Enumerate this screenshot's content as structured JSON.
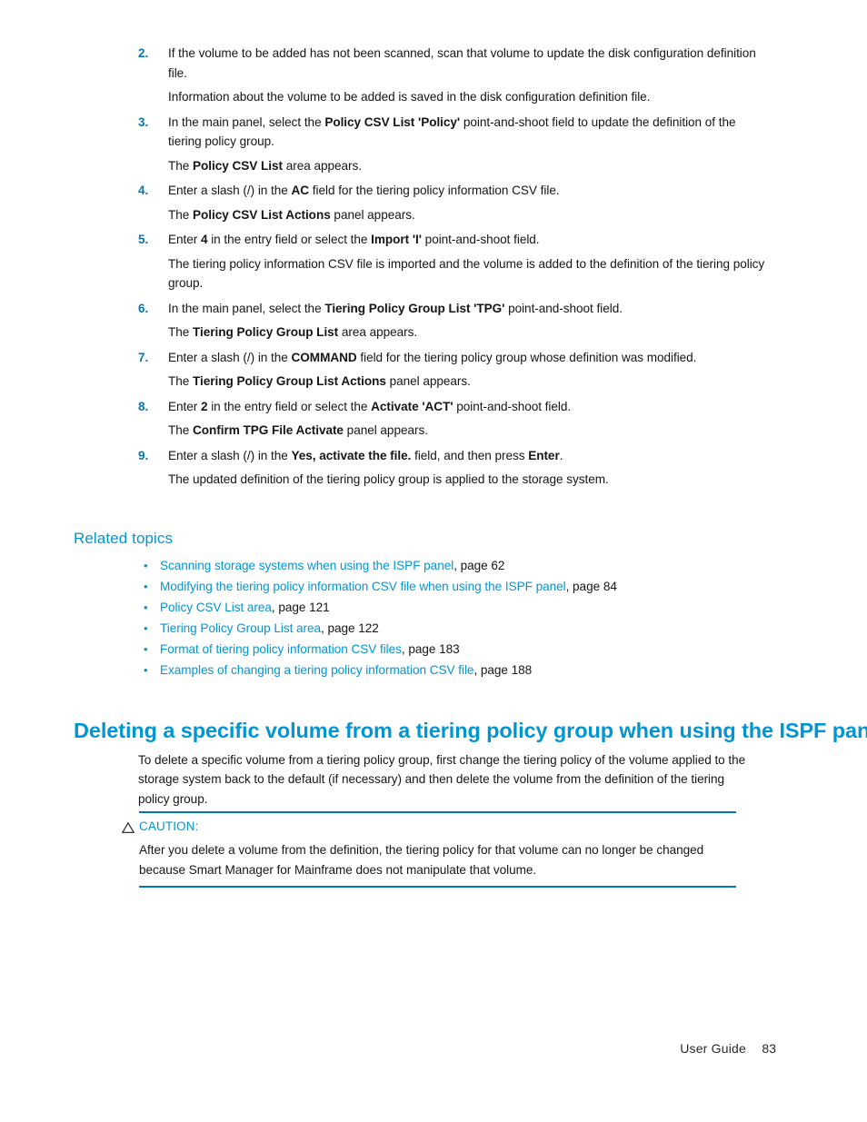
{
  "document": {
    "type": "user-guide-page",
    "colors": {
      "heading_blue": "#0096D6",
      "list_number_blue": "#0078B4",
      "rule_blue": "#0079B8",
      "body_text": "#161616",
      "background": "#FFFFFF"
    }
  },
  "procedure": {
    "steps": [
      {
        "number": "2.",
        "text_parts": [
          {
            "text": "If the volume to be added has not been scanned, scan that volume to update the disk configuration definition file.",
            "bold": false
          }
        ],
        "result": [
          {
            "text": "Information about the volume to be added is saved in the disk configuration definition file.",
            "bold": false
          }
        ]
      },
      {
        "number": "3.",
        "text_parts": [
          {
            "text": "In the main panel, select the ",
            "bold": false
          },
          {
            "text": "Policy CSV List 'Policy'",
            "bold": true
          },
          {
            "text": " point-and-shoot field to update the definition of the tiering policy group.",
            "bold": false
          }
        ],
        "result": [
          {
            "text": "The ",
            "bold": false
          },
          {
            "text": "Policy CSV List",
            "bold": true
          },
          {
            "text": " area appears.",
            "bold": false
          }
        ]
      },
      {
        "number": "4.",
        "text_parts": [
          {
            "text": "Enter a slash (/) in the ",
            "bold": false
          },
          {
            "text": "AC",
            "bold": true
          },
          {
            "text": " field for the tiering policy information CSV file.",
            "bold": false
          }
        ],
        "result": [
          {
            "text": "The ",
            "bold": false
          },
          {
            "text": "Policy CSV List Actions",
            "bold": true
          },
          {
            "text": " panel appears.",
            "bold": false
          }
        ]
      },
      {
        "number": "5.",
        "text_parts": [
          {
            "text": "Enter ",
            "bold": false
          },
          {
            "text": "4",
            "bold": true
          },
          {
            "text": " in the entry field or select the ",
            "bold": false
          },
          {
            "text": "Import 'I'",
            "bold": true
          },
          {
            "text": " point-and-shoot field.",
            "bold": false
          }
        ],
        "result": [
          {
            "text": "The tiering policy information CSV file is imported and the volume is added to the definition of the tiering policy group.",
            "bold": false
          }
        ]
      },
      {
        "number": "6.",
        "text_parts": [
          {
            "text": "In the main panel, select the ",
            "bold": false
          },
          {
            "text": "Tiering Policy Group List 'TPG'",
            "bold": true
          },
          {
            "text": " point-and-shoot field.",
            "bold": false
          }
        ],
        "result": [
          {
            "text": "The ",
            "bold": false
          },
          {
            "text": "Tiering Policy Group List",
            "bold": true
          },
          {
            "text": " area appears.",
            "bold": false
          }
        ]
      },
      {
        "number": "7.",
        "text_parts": [
          {
            "text": "Enter a slash (/) in the ",
            "bold": false
          },
          {
            "text": "COMMAND",
            "bold": true
          },
          {
            "text": " field for the tiering policy group whose definition was modified.",
            "bold": false
          }
        ],
        "result": [
          {
            "text": "The ",
            "bold": false
          },
          {
            "text": "Tiering Policy Group List Actions",
            "bold": true
          },
          {
            "text": " panel appears.",
            "bold": false
          }
        ]
      },
      {
        "number": "8.",
        "text_parts": [
          {
            "text": "Enter ",
            "bold": false
          },
          {
            "text": "2",
            "bold": true
          },
          {
            "text": " in the entry field or select the ",
            "bold": false
          },
          {
            "text": "Activate 'ACT'",
            "bold": true
          },
          {
            "text": " point-and-shoot field.",
            "bold": false
          }
        ],
        "result": [
          {
            "text": "The ",
            "bold": false
          },
          {
            "text": "Confirm TPG File Activate",
            "bold": true
          },
          {
            "text": " panel appears.",
            "bold": false
          }
        ]
      },
      {
        "number": "9.",
        "text_parts": [
          {
            "text": "Enter a slash (/) in the ",
            "bold": false
          },
          {
            "text": "Yes, activate the file.",
            "bold": true
          },
          {
            "text": " field, and then press ",
            "bold": false
          },
          {
            "text": "Enter",
            "bold": true
          },
          {
            "text": ".",
            "bold": false
          }
        ],
        "result": [
          {
            "text": "The updated definition of the tiering policy group is applied to the storage system.",
            "bold": false
          }
        ]
      }
    ]
  },
  "related_topics": {
    "heading": "Related topics",
    "bullet_glyph": "•",
    "items": [
      {
        "link": "Scanning storage systems when using the ISPF panel",
        "page_text": ", page 62"
      },
      {
        "link": "Modifying the tiering policy information CSV file when using the ISPF panel",
        "page_text": ", page 84"
      },
      {
        "link": "Policy CSV List area",
        "page_text": ", page 121"
      },
      {
        "link": "Tiering Policy Group List area",
        "page_text": ", page 122"
      },
      {
        "link": "Format of tiering policy information CSV files",
        "page_text": ", page 183"
      },
      {
        "link": "Examples of changing a tiering policy information CSV file",
        "page_text": ", page 188"
      }
    ]
  },
  "section": {
    "heading": "Deleting a specific volume from a tiering policy group when using the ISPF panel",
    "body": "To delete a specific volume from a tiering policy group, first change the tiering policy of the volume applied to the storage system back to the default (if necessary) and then delete the volume from the definition of the tiering policy group."
  },
  "caution": {
    "icon": "warning-triangle-icon",
    "label": "CAUTION:",
    "body": "After you delete a volume from the definition, the tiering policy for that volume can no longer be changed because Smart Manager for Mainframe does not manipulate that volume."
  },
  "footer": {
    "label": "User Guide",
    "page_number": "83"
  }
}
